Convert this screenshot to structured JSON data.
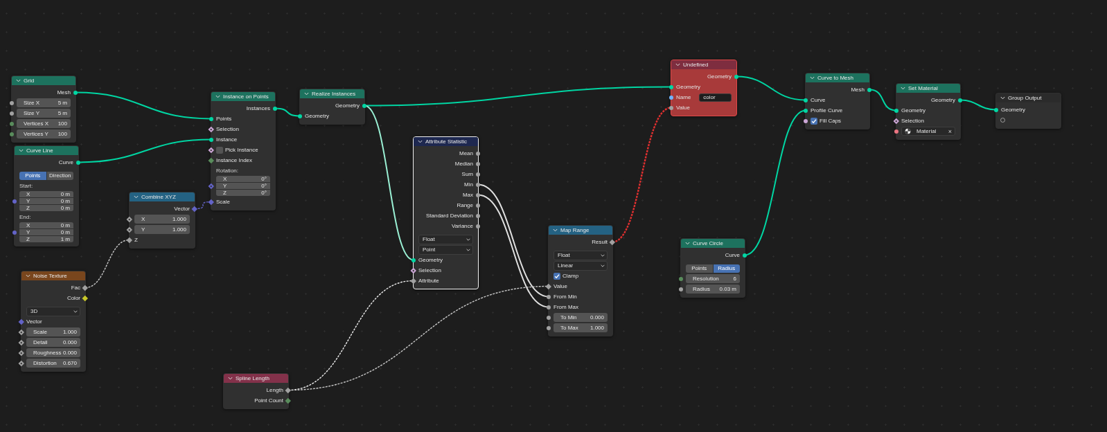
{
  "nodes": [
    {
      "title": "Grid",
      "color": "#1d725e",
      "selected": false,
      "error": false,
      "rows": [
        {
          "kind": "output",
          "label": "Mesh",
          "socket": {
            "color": "#00d6a3",
            "kind": "circle"
          }
        },
        {
          "kind": "field",
          "label": "Size X",
          "value": "5 m",
          "socket": {
            "color": "#a1a1a1",
            "kind": "circle"
          }
        },
        {
          "kind": "field",
          "label": "Size Y",
          "value": "5 m",
          "socket": {
            "color": "#a1a1a1",
            "kind": "circle"
          }
        },
        {
          "kind": "field",
          "label": "Vertices X",
          "value": "100",
          "socket": {
            "color": "#598c5c",
            "kind": "circle"
          }
        },
        {
          "kind": "field",
          "label": "Vertices Y",
          "value": "100",
          "socket": {
            "color": "#598c5c",
            "kind": "circle"
          }
        }
      ]
    },
    {
      "title": "Curve Line",
      "color": "#1d725e",
      "selected": false,
      "error": false,
      "rows": [
        {
          "kind": "output",
          "label": "Curve",
          "socket": {
            "color": "#00d6a3",
            "kind": "circle"
          }
        },
        {
          "kind": "enum",
          "options": [
            {
              "label": "Points",
              "selected": true
            },
            {
              "label": "Direction",
              "selected": false
            }
          ]
        },
        {
          "kind": "heading",
          "label": "Start:"
        },
        {
          "kind": "vector",
          "fields": [
            {
              "label": "X",
              "value": "0 m"
            },
            {
              "label": "Y",
              "value": "0 m"
            },
            {
              "label": "Z",
              "value": "0 m"
            }
          ],
          "socket": {
            "color": "#6363c7",
            "kind": "circle"
          }
        },
        {
          "kind": "heading",
          "label": "End:"
        },
        {
          "kind": "vector",
          "fields": [
            {
              "label": "X",
              "value": "0 m"
            },
            {
              "label": "Y",
              "value": "0 m"
            },
            {
              "label": "Z",
              "value": "1 m"
            }
          ],
          "socket": {
            "color": "#6363c7",
            "kind": "circle"
          }
        }
      ]
    },
    {
      "title": "Combine XYZ",
      "color": "#246283",
      "selected": false,
      "error": false,
      "rows": [
        {
          "kind": "output",
          "label": "Vector",
          "socket": {
            "color": "#6363c7",
            "kind": "diamond"
          }
        },
        {
          "kind": "field",
          "label": "X",
          "value": "1.000",
          "socket": {
            "color": "#a1a1a1",
            "kind": "dotted"
          }
        },
        {
          "kind": "field",
          "label": "Y",
          "value": "1.000",
          "socket": {
            "color": "#a1a1a1",
            "kind": "dotted"
          }
        },
        {
          "kind": "input",
          "label": "Z",
          "socket": {
            "color": "#a1a1a1",
            "kind": "diamond"
          }
        }
      ]
    },
    {
      "title": "Noise Texture",
      "color": "#79461d",
      "selected": false,
      "error": false,
      "rows": [
        {
          "kind": "output",
          "label": "Fac",
          "socket": {
            "color": "#a1a1a1",
            "kind": "diamond"
          }
        },
        {
          "kind": "output",
          "label": "Color",
          "socket": {
            "color": "#c7c729",
            "kind": "diamond"
          }
        },
        {
          "kind": "dropdown",
          "value": "3D"
        },
        {
          "kind": "input",
          "label": "Vector",
          "socket": {
            "color": "#6363c7",
            "kind": "diamond"
          }
        },
        {
          "kind": "field",
          "label": "Scale",
          "value": "1.000",
          "socket": {
            "color": "#a1a1a1",
            "kind": "dotted"
          }
        },
        {
          "kind": "field",
          "label": "Detail",
          "value": "0.000",
          "socket": {
            "color": "#a1a1a1",
            "kind": "dotted"
          }
        },
        {
          "kind": "field",
          "label": "Roughness",
          "value": "0.000",
          "socket": {
            "color": "#a1a1a1",
            "kind": "dotted"
          }
        },
        {
          "kind": "field",
          "label": "Distortion",
          "value": "0.670",
          "socket": {
            "color": "#a1a1a1",
            "kind": "dotted"
          }
        }
      ]
    },
    {
      "title": "Instance on Points",
      "color": "#1d725e",
      "selected": false,
      "error": false,
      "rows": [
        {
          "kind": "output",
          "label": "Instances",
          "socket": {
            "color": "#00d6a3",
            "kind": "circle"
          }
        },
        {
          "kind": "input",
          "label": "Points",
          "socket": {
            "color": "#00d6a3",
            "kind": "circle"
          }
        },
        {
          "kind": "input",
          "label": "Selection",
          "socket": {
            "color": "#cca6d6",
            "kind": "dotted"
          }
        },
        {
          "kind": "input",
          "label": "Instance",
          "socket": {
            "color": "#00d6a3",
            "kind": "circle"
          }
        },
        {
          "kind": "checkbox",
          "label": "Pick Instance",
          "checked": false,
          "socket": {
            "color": "#cca6d6",
            "kind": "dotted"
          }
        },
        {
          "kind": "input",
          "label": "Instance Index",
          "socket": {
            "color": "#598c5c",
            "kind": "diamond"
          }
        },
        {
          "kind": "heading",
          "label": "Rotation:"
        },
        {
          "kind": "vector",
          "fields": [
            {
              "label": "X",
              "value": "0°"
            },
            {
              "label": "Y",
              "value": "0°"
            },
            {
              "label": "Z",
              "value": "0°"
            }
          ],
          "socket": {
            "color": "#6363c7",
            "kind": "dotted"
          }
        },
        {
          "kind": "input",
          "label": "Scale",
          "socket": {
            "color": "#6363c7",
            "kind": "diamond"
          }
        }
      ]
    },
    {
      "title": "Realize Instances",
      "color": "#1d725e",
      "selected": false,
      "error": false,
      "rows": [
        {
          "kind": "output",
          "label": "Geometry",
          "socket": {
            "color": "#00d6a3",
            "kind": "circle"
          }
        },
        {
          "kind": "input",
          "label": "Geometry",
          "socket": {
            "color": "#00d6a3",
            "kind": "circle"
          }
        }
      ]
    },
    {
      "title": "Attribute Statistic",
      "color": "#1e2850",
      "selected": true,
      "error": false,
      "rows": [
        {
          "kind": "output",
          "label": "Mean",
          "socket": {
            "color": "#a1a1a1",
            "kind": "circle"
          }
        },
        {
          "kind": "output",
          "label": "Median",
          "socket": {
            "color": "#a1a1a1",
            "kind": "circle"
          }
        },
        {
          "kind": "output",
          "label": "Sum",
          "socket": {
            "color": "#a1a1a1",
            "kind": "circle"
          }
        },
        {
          "kind": "output",
          "label": "Min",
          "socket": {
            "color": "#a1a1a1",
            "kind": "circle"
          }
        },
        {
          "kind": "output",
          "label": "Max",
          "socket": {
            "color": "#a1a1a1",
            "kind": "circle"
          }
        },
        {
          "kind": "output",
          "label": "Range",
          "socket": {
            "color": "#a1a1a1",
            "kind": "circle"
          }
        },
        {
          "kind": "output",
          "label": "Standard Deviation",
          "socket": {
            "color": "#a1a1a1",
            "kind": "circle"
          }
        },
        {
          "kind": "output",
          "label": "Variance",
          "socket": {
            "color": "#a1a1a1",
            "kind": "circle"
          }
        },
        {
          "kind": "dropdown",
          "value": "Float"
        },
        {
          "kind": "dropdown",
          "value": "Point"
        },
        {
          "kind": "input",
          "label": "Geometry",
          "socket": {
            "color": "#00d6a3",
            "kind": "circle"
          }
        },
        {
          "kind": "input",
          "label": "Selection",
          "socket": {
            "color": "#cca6d6",
            "kind": "dotted"
          }
        },
        {
          "kind": "input",
          "label": "Attribute",
          "socket": {
            "color": "#a1a1a1",
            "kind": "diamond"
          }
        }
      ]
    },
    {
      "title": "Map Range",
      "color": "#246283",
      "selected": false,
      "error": false,
      "rows": [
        {
          "kind": "output",
          "label": "Result",
          "socket": {
            "color": "#a1a1a1",
            "kind": "diamond"
          }
        },
        {
          "kind": "dropdown",
          "value": "Float"
        },
        {
          "kind": "dropdown",
          "value": "Linear"
        },
        {
          "kind": "checkbox",
          "label": "Clamp",
          "checked": true
        },
        {
          "kind": "input",
          "label": "Value",
          "socket": {
            "color": "#a1a1a1",
            "kind": "diamond"
          }
        },
        {
          "kind": "input",
          "label": "From Min",
          "socket": {
            "color": "#a1a1a1",
            "kind": "circle"
          }
        },
        {
          "kind": "input",
          "label": "From Max",
          "socket": {
            "color": "#a1a1a1",
            "kind": "circle"
          }
        },
        {
          "kind": "field",
          "label": "To Min",
          "value": "0.000",
          "socket": {
            "color": "#a1a1a1",
            "kind": "circle"
          }
        },
        {
          "kind": "field",
          "label": "To Max",
          "value": "1.000",
          "socket": {
            "color": "#a1a1a1",
            "kind": "circle"
          }
        }
      ]
    },
    {
      "title": "Spline Length",
      "color": "#83314a",
      "selected": false,
      "error": false,
      "rows": [
        {
          "kind": "output",
          "label": "Length",
          "socket": {
            "color": "#a1a1a1",
            "kind": "diamond"
          }
        },
        {
          "kind": "output",
          "label": "Point Count",
          "socket": {
            "color": "#598c5c",
            "kind": "diamond"
          }
        }
      ]
    },
    {
      "title": "Undefined",
      "color": "#7e2d3f",
      "selected": false,
      "error": true,
      "rows": [
        {
          "kind": "output",
          "label": "Geometry",
          "socket": {
            "color": "#00d6a3",
            "kind": "circle"
          }
        },
        {
          "kind": "input",
          "label": "Geometry",
          "socket": {
            "color": "#00d6a3",
            "kind": "circle"
          }
        },
        {
          "kind": "text",
          "label": "Name",
          "value": "color",
          "socket": {
            "color": "#70b2ff",
            "kind": "circle"
          }
        },
        {
          "kind": "input",
          "label": "Value",
          "socket": {
            "color": "#a1a1a1",
            "kind": "circle"
          }
        }
      ]
    },
    {
      "title": "Curve Circle",
      "color": "#1d725e",
      "selected": false,
      "error": false,
      "rows": [
        {
          "kind": "output",
          "label": "Curve",
          "socket": {
            "color": "#00d6a3",
            "kind": "circle"
          }
        },
        {
          "kind": "enum",
          "options": [
            {
              "label": "Points",
              "selected": false
            },
            {
              "label": "Radius",
              "selected": true
            }
          ]
        },
        {
          "kind": "field",
          "label": "Resolution",
          "value": "6",
          "socket": {
            "color": "#598c5c",
            "kind": "circle"
          }
        },
        {
          "kind": "field",
          "label": "Radius",
          "value": "0.03 m",
          "socket": {
            "color": "#a1a1a1",
            "kind": "circle"
          }
        }
      ]
    },
    {
      "title": "Curve to Mesh",
      "color": "#1d725e",
      "selected": false,
      "error": false,
      "rows": [
        {
          "kind": "output",
          "label": "Mesh",
          "socket": {
            "color": "#00d6a3",
            "kind": "circle"
          }
        },
        {
          "kind": "input",
          "label": "Curve",
          "socket": {
            "color": "#00d6a3",
            "kind": "circle"
          }
        },
        {
          "kind": "input",
          "label": "Profile Curve",
          "socket": {
            "color": "#00d6a3",
            "kind": "circle"
          }
        },
        {
          "kind": "checkbox",
          "label": "Fill Caps",
          "checked": true,
          "socket": {
            "color": "#cca6d6",
            "kind": "circle"
          }
        }
      ]
    },
    {
      "title": "Set Material",
      "color": "#1d725e",
      "selected": false,
      "error": false,
      "rows": [
        {
          "kind": "output",
          "label": "Geometry",
          "socket": {
            "color": "#00d6a3",
            "kind": "circle"
          }
        },
        {
          "kind": "input",
          "label": "Geometry",
          "socket": {
            "color": "#00d6a3",
            "kind": "circle"
          }
        },
        {
          "kind": "input",
          "label": "Selection",
          "socket": {
            "color": "#cca6d6",
            "kind": "dotted"
          }
        },
        {
          "kind": "material",
          "value": "Material",
          "clear": "×",
          "socket": {
            "color": "#eb7582",
            "kind": "circle"
          }
        }
      ]
    },
    {
      "title": "Group Output",
      "color": "#2b2b2b",
      "selected": false,
      "error": false,
      "rows": [
        {
          "kind": "input",
          "label": "Geometry",
          "socket": {
            "color": "#00d6a3",
            "kind": "circle"
          }
        },
        {
          "kind": "socket_only",
          "socket": {
            "kind": "hollow"
          }
        }
      ]
    }
  ],
  "links": [
    {
      "kind": "geometry"
    },
    {
      "kind": "geometry"
    },
    {
      "kind": "vector_field"
    },
    {
      "kind": "field"
    },
    {
      "kind": "geometry"
    },
    {
      "kind": "geometry"
    },
    {
      "kind": "geometry"
    },
    {
      "kind": "float"
    },
    {
      "kind": "float"
    },
    {
      "kind": "field"
    },
    {
      "kind": "field"
    },
    {
      "kind": "invalid"
    },
    {
      "kind": "geometry"
    },
    {
      "kind": "geometry"
    },
    {
      "kind": "geometry"
    },
    {
      "kind": "geometry"
    }
  ]
}
